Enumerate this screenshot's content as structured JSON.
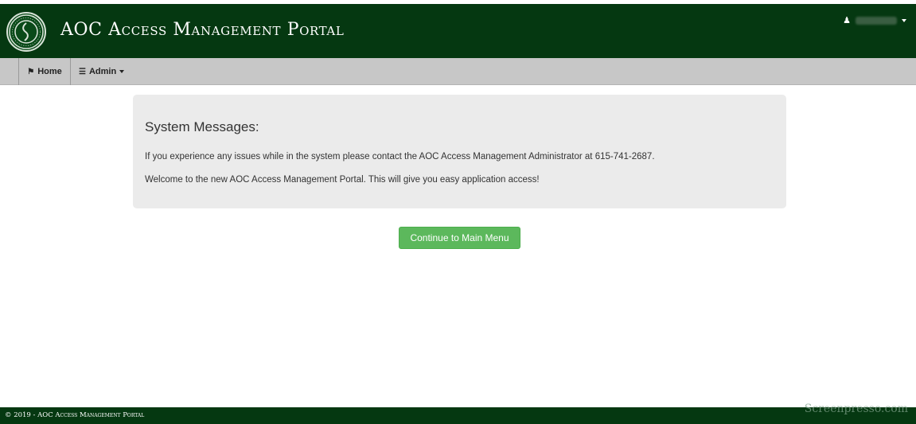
{
  "header": {
    "title": "AOC Access Management Portal",
    "logo_icon": "court-seal-icon",
    "user_icon": "user-icon"
  },
  "nav": {
    "items": [
      {
        "label": "Home",
        "icon": "home-icon"
      },
      {
        "label": "Admin",
        "icon": "list-icon"
      }
    ]
  },
  "messages": {
    "title": "System Messages:",
    "lines": [
      "If you experience any issues while in the system please contact the AOC Access Management Administrator at 615-741-2687.",
      "Welcome to the new AOC Access Management Portal. This will give you easy application access!"
    ]
  },
  "actions": {
    "continue_label": "Continue to Main Menu"
  },
  "footer": {
    "text": "© 2019 - AOC Access Management Portal"
  },
  "watermark": "Screenpresso.com",
  "colors": {
    "header_bg": "#053811",
    "nav_bg": "#c7c7c7",
    "panel_bg": "#ebebeb",
    "button": "#5cb85c"
  }
}
